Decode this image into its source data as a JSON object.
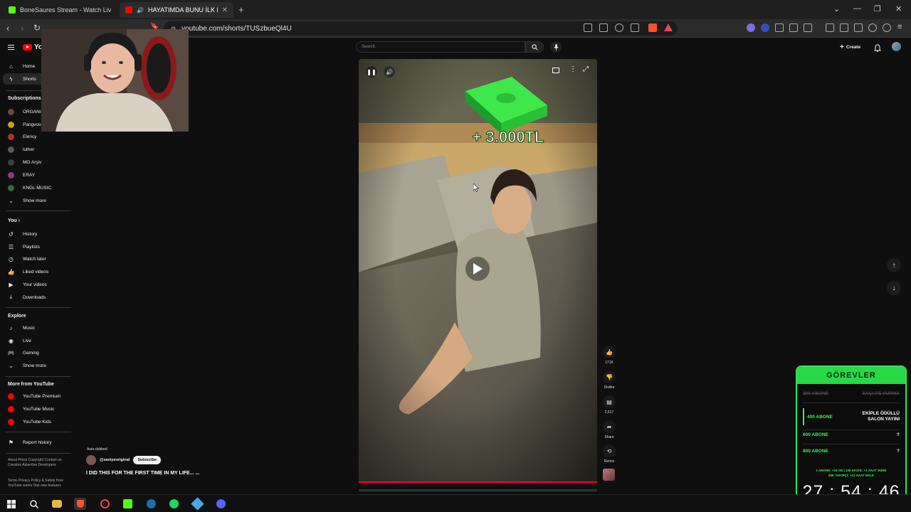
{
  "browser": {
    "tabs": [
      {
        "title": "BoneSaures Stream - Watch Live on K",
        "active": false
      },
      {
        "title": "HAYATIMDA BUNU İLK DEFA Y",
        "active": true
      }
    ],
    "url": "youtube.com/shorts/TUSzbueQl4U"
  },
  "youtube": {
    "logo": "YouTube",
    "logo_region": "TR",
    "search_placeholder": "Search",
    "create_label": "Create",
    "sidebar": {
      "main": [
        {
          "label": "Home",
          "icon": "home-icon"
        },
        {
          "label": "Shorts",
          "icon": "shorts-icon",
          "active": true
        }
      ],
      "subscriptions_title": "Subscriptions",
      "subscriptions": [
        {
          "label": "ORGANIZE34",
          "color": "#6a4a3a"
        },
        {
          "label": "Pangvoss",
          "color": "#c8a020"
        },
        {
          "label": "Elency",
          "color": "#b03030"
        },
        {
          "label": "luther",
          "color": "#5a5a5a"
        },
        {
          "label": "MO Arşiv",
          "color": "#404040"
        },
        {
          "label": "ERAY",
          "color": "#8a3a7a"
        },
        {
          "label": "KNGL MUSIC",
          "color": "#3a6a3a"
        }
      ],
      "subs_show_more": "Show more",
      "you_title": "You",
      "you": [
        {
          "label": "History",
          "icon": "history-icon"
        },
        {
          "label": "Playlists",
          "icon": "playlists-icon"
        },
        {
          "label": "Watch later",
          "icon": "watch-later-icon"
        },
        {
          "label": "Liked videos",
          "icon": "like-icon"
        },
        {
          "label": "Your videos",
          "icon": "your-videos-icon"
        },
        {
          "label": "Downloads",
          "icon": "download-icon"
        }
      ],
      "explore_title": "Explore",
      "explore": [
        {
          "label": "Music",
          "icon": "music-icon"
        },
        {
          "label": "Live",
          "icon": "live-icon"
        },
        {
          "label": "Gaming",
          "icon": "gaming-icon"
        }
      ],
      "explore_show_more": "Show more",
      "more_title": "More from YouTube",
      "more": [
        {
          "label": "YouTube Premium"
        },
        {
          "label": "YouTube Music"
        },
        {
          "label": "YouTube Kids"
        }
      ],
      "report_history": "Report history",
      "footer1": "About  Press  Copyright  Contact us  Creators  Advertise  Developers",
      "footer2": "Terms  Privacy  Policy & Safety  How YouTube works  Test new features"
    },
    "short": {
      "overlay_text": "+ 3.000TL",
      "likes": "171K",
      "dislike_label": "Dislike",
      "comments": "2,517",
      "share_label": "Share",
      "remix_label": "Remix",
      "auto_dubbed": "Auto-dubbed",
      "channel": "@saniyeoriginal",
      "subscribe_label": "Subscribe",
      "title": "I DID THIS FOR THE FIRST TIME IN MY LIFE... ..."
    }
  },
  "goals_widget": {
    "title": "GÖREVLER",
    "rows": [
      {
        "goal": "200 ABONE",
        "reward": "SAÇI 3'E VURMA",
        "state": "done"
      },
      {
        "goal": "400 ABONE",
        "reward": "EKİPLE ÖDÜLLÜ SALON YAYINI",
        "state": "current"
      },
      {
        "goal": "600 ABONE",
        "reward": "?",
        "state": "pending"
      },
      {
        "goal": "800 ABONE",
        "reward": "?",
        "state": "pending"
      }
    ],
    "stats_line1": "1 ABONE: +15 SN | 100 KICKS: +1 SAAT SÜRE",
    "stats_line2": "50K TAKİPÇİ: +12 SAAT EKLE",
    "timer": "27 : 54 : 46",
    "accent": "#27d847"
  }
}
